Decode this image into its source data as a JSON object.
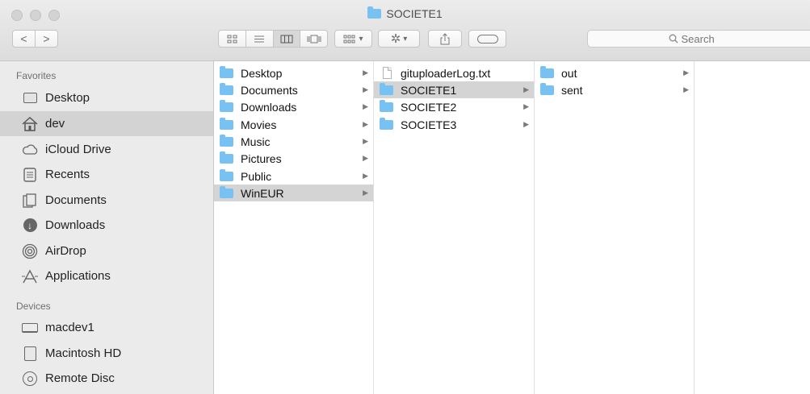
{
  "window": {
    "title": "SOCIETE1"
  },
  "toolbar": {
    "back_label": "<",
    "forward_label": ">",
    "view_modes": [
      "icon-view-icon",
      "list-view-icon",
      "column-view-icon",
      "gallery-view-icon"
    ],
    "selected_view": "column-view-icon",
    "arrange_label": "▾",
    "action_label": "▾",
    "search_placeholder": "Search"
  },
  "sidebar": {
    "favorites_header": "Favorites",
    "favorites": [
      {
        "label": "Desktop",
        "icon": "desktop-icon"
      },
      {
        "label": "dev",
        "icon": "home-icon",
        "selected": true
      },
      {
        "label": "iCloud Drive",
        "icon": "cloud-icon"
      },
      {
        "label": "Recents",
        "icon": "recents-icon"
      },
      {
        "label": "Documents",
        "icon": "documents-icon"
      },
      {
        "label": "Downloads",
        "icon": "downloads-icon"
      },
      {
        "label": "AirDrop",
        "icon": "airdrop-icon"
      },
      {
        "label": "Applications",
        "icon": "applications-icon"
      }
    ],
    "devices_header": "Devices",
    "devices": [
      {
        "label": "macdev1",
        "icon": "laptop-icon"
      },
      {
        "label": "Macintosh HD",
        "icon": "hard-drive-icon"
      },
      {
        "label": "Remote Disc",
        "icon": "disc-icon"
      }
    ]
  },
  "columns": {
    "col1": [
      {
        "label": "Desktop"
      },
      {
        "label": "Documents"
      },
      {
        "label": "Downloads"
      },
      {
        "label": "Movies"
      },
      {
        "label": "Music"
      },
      {
        "label": "Pictures"
      },
      {
        "label": "Public"
      },
      {
        "label": "WinEUR",
        "selected": true
      }
    ],
    "col2": [
      {
        "label": "gituploaderLog.txt",
        "type": "file"
      },
      {
        "label": "SOCIETE1",
        "selected": true
      },
      {
        "label": "SOCIETE2"
      },
      {
        "label": "SOCIETE3"
      }
    ],
    "col3": [
      {
        "label": "out"
      },
      {
        "label": "sent"
      }
    ]
  },
  "colors": {
    "folder": "#78c1f3",
    "selection": "#d4d4d4",
    "sidebar_bg": "#ecebec"
  }
}
